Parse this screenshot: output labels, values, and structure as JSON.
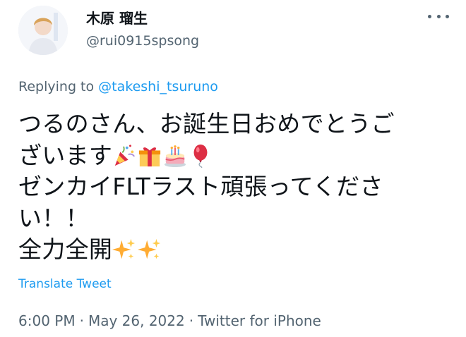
{
  "author": {
    "display_name": "木原 瑠生",
    "handle": "@rui0915spsong"
  },
  "reply": {
    "prefix": "Replying to",
    "user": "@takeshi_tsuruno"
  },
  "tweet": {
    "lines": [
      "つるのさん、お誕生日おめでとうご",
      "ざいます",
      "ゼンカイFLTラスト頑張ってくださ",
      "い！！",
      "全力全開"
    ],
    "emojis_line2": [
      "party-popper-icon",
      "gift-icon",
      "birthday-cake-icon",
      "balloon-icon"
    ],
    "emojis_line5": [
      "sparkles-icon",
      "sparkles-icon"
    ]
  },
  "translate": "Translate Tweet",
  "meta": {
    "time": "6:00 PM",
    "date": "May 26, 2022",
    "source": "Twitter for iPhone",
    "separator": "·"
  },
  "colors": {
    "text": "#0f1419",
    "secondary": "#536471",
    "link": "#1d9bf0"
  }
}
